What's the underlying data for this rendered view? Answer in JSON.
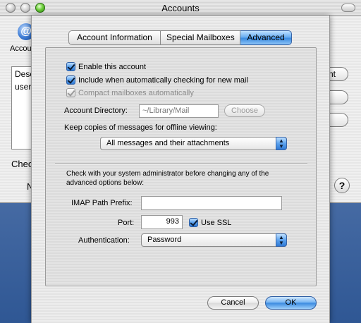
{
  "window": {
    "title": "Accounts",
    "accounts_label": "Accounts",
    "accounts_icon_glyph": "@",
    "list_header": "Description",
    "list_row": "user",
    "check_label": "Check",
    "n_label": "N",
    "right_button_1": "nt",
    "help_glyph": "?"
  },
  "sheet": {
    "tabs": [
      "Account Information",
      "Special Mailboxes",
      "Advanced"
    ],
    "selected_tab": "Advanced",
    "enable_account_label": "Enable this account",
    "include_checking_label": "Include when automatically checking for new mail",
    "compact_mailboxes_label": "Compact mailboxes automatically",
    "account_directory_label": "Account Directory:",
    "account_directory_value": "~/Library/Mail",
    "choose_button": "Choose",
    "keep_copies_label": "Keep copies of messages for offline viewing:",
    "keep_copies_value": "All messages and their attachments",
    "warning_text": "Check with your system administrator before changing any of the advanced options below:",
    "imap_prefix_label": "IMAP Path Prefix:",
    "imap_prefix_value": "",
    "port_label": "Port:",
    "port_value": "993",
    "use_ssl_label": "Use SSL",
    "authentication_label": "Authentication:",
    "authentication_value": "Password",
    "cancel_button": "Cancel",
    "ok_button": "OK"
  },
  "icons": {
    "popup_arrows": "up-down-arrows-icon",
    "check": "checkmark-icon"
  },
  "colors": {
    "aqua_blue": "#3b8be0",
    "desktop": "#4a6ea6"
  }
}
